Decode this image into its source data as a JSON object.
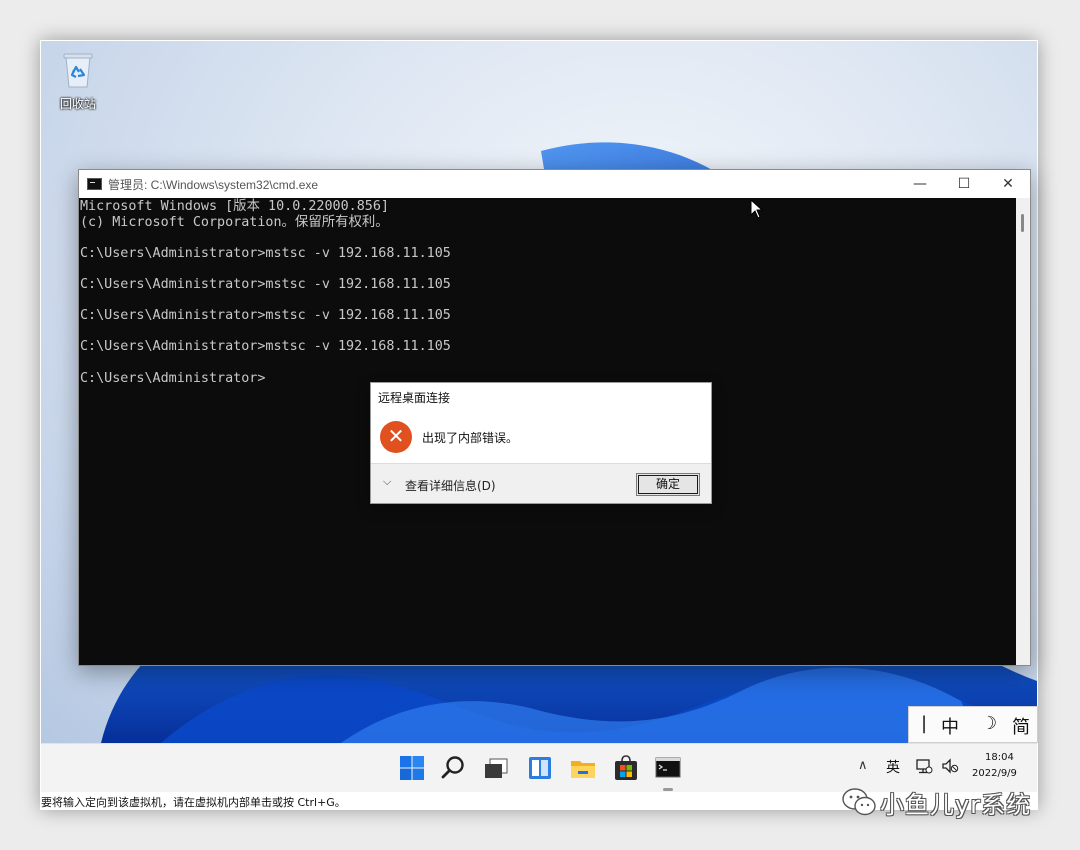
{
  "desktop": {
    "recycle_bin_label": "回收站"
  },
  "cmd_window": {
    "title": "管理员: C:\\Windows\\system32\\cmd.exe",
    "controls": {
      "minimize": "—",
      "maximize": "☐",
      "close": "✕"
    },
    "lines": [
      "Microsoft Windows [版本 10.0.22000.856]",
      "(c) Microsoft Corporation。保留所有权利。",
      "",
      "C:\\Users\\Administrator>mstsc -v 192.168.11.105",
      "",
      "C:\\Users\\Administrator>mstsc -v 192.168.11.105",
      "",
      "C:\\Users\\Administrator>mstsc -v 192.168.11.105",
      "",
      "C:\\Users\\Administrator>mstsc -v 192.168.11.105",
      "",
      "C:\\Users\\Administrator>"
    ]
  },
  "dialog": {
    "title": "远程桌面连接",
    "message": "出现了内部错误。",
    "details_label": "查看详细信息(D)",
    "ok_label": "确定",
    "error_glyph": "✕",
    "chevron_glyph": "⌵"
  },
  "ime_bar": {
    "grip": "|",
    "mode": "中",
    "moon": "☽",
    "script": "简"
  },
  "taskbar": {
    "pinned": [
      "start-icon",
      "search-icon",
      "task-view-icon",
      "widgets-icon",
      "file-explorer-icon",
      "store-icon",
      "terminal-icon"
    ],
    "tray_chevron": "∧",
    "language": "英",
    "time": "18:04",
    "date": "2022/9/9"
  },
  "vm_status_bar": {
    "text": "要将输入定向到该虚拟机，请在虚拟机内部单击或按 Ctrl+G。"
  },
  "watermark": {
    "text": "小鱼儿yr系统"
  },
  "colors": {
    "console_bg": "#0c0c0c",
    "console_fg": "#c8c8c8",
    "error_red": "#e0511f",
    "windows_blue": "#0a5bd6"
  }
}
